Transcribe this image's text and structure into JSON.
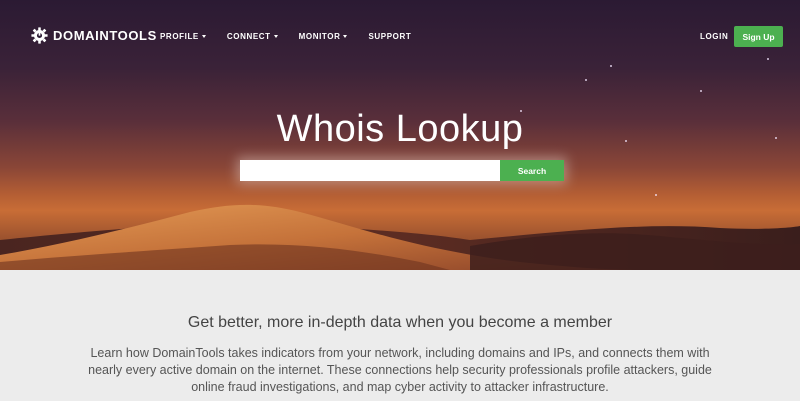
{
  "brand": {
    "name": "DOMAINTOOLS",
    "logo_icon": "domaintools-gear-logo-icon"
  },
  "nav": {
    "items": [
      {
        "label": "PROFILE",
        "has_caret": true
      },
      {
        "label": "CONNECT",
        "has_caret": true
      },
      {
        "label": "MONITOR",
        "has_caret": true
      },
      {
        "label": "SUPPORT",
        "has_caret": false
      }
    ],
    "login_label": "LOGIN",
    "signup_label": "Sign Up"
  },
  "hero": {
    "title": "Whois Lookup",
    "search_value": "",
    "search_placeholder": "",
    "search_button_label": "Search"
  },
  "member": {
    "heading": "Get better, more in-depth data when you become a member",
    "body": "Learn how DomainTools takes indicators from your network, including domains and IPs, and connects them with nearly every active domain on the internet. These connections help security professionals profile attackers, guide online fraud investigations, and map cyber activity to attacker infrastructure."
  },
  "colors": {
    "accent_green": "#4cb050",
    "member_background": "#ececec",
    "text_dark": "#444444"
  }
}
